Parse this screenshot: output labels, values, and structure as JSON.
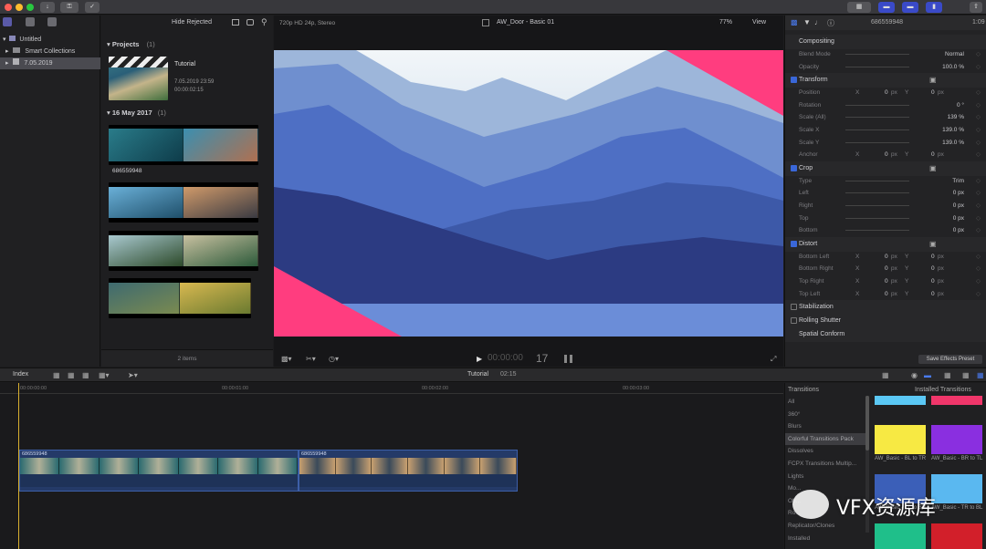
{
  "toolbar": {
    "icons": [
      "download-icon",
      "key-icon",
      "check-circle-icon"
    ],
    "right_icons": [
      "keyword-icon",
      "layout-browser-icon",
      "layout-timeline-icon",
      "layout-inspector-icon",
      "share-icon"
    ]
  },
  "library": {
    "items": [
      {
        "label": "Untitled",
        "icon": "library-icon"
      },
      {
        "label": "Smart Collections",
        "icon": "folder-icon"
      },
      {
        "label": "7.05.2019",
        "icon": "event-icon"
      }
    ]
  },
  "browser": {
    "filter": "Hide Rejected",
    "sections": [
      {
        "title": "Projects",
        "count": "(1)"
      },
      {
        "title": "16 May 2017",
        "count": "(1)"
      }
    ],
    "project": {
      "name": "Tutorial",
      "date": "7.05.2019 23:59",
      "duration": "00:00:02:15"
    },
    "clip_label": "686559948",
    "footer": "2 items"
  },
  "viewer": {
    "format": "720p HD 24p, Stereo",
    "title": "AW_Door - Basic 01",
    "zoom": "77%",
    "view": "View",
    "timecode_dim": "00:00:00",
    "timecode": "17",
    "accent_pink": "#ff3d7f"
  },
  "inspector": {
    "clip_name": "686559948",
    "duration": "1:09",
    "rows": [
      {
        "type": "head",
        "label": "Compositing"
      },
      {
        "type": "row",
        "label": "Blend Mode",
        "value": "Normal"
      },
      {
        "type": "row",
        "label": "Opacity",
        "value": "100.0 %"
      },
      {
        "type": "chk",
        "label": "Transform"
      },
      {
        "type": "xy",
        "label": "Position",
        "x": "0",
        "y": "0",
        "unit": "px"
      },
      {
        "type": "row",
        "label": "Rotation",
        "value": "0 °"
      },
      {
        "type": "row",
        "label": "Scale (All)",
        "value": "139 %"
      },
      {
        "type": "row",
        "label": "Scale X",
        "value": "139.0 %"
      },
      {
        "type": "row",
        "label": "Scale Y",
        "value": "139.0 %"
      },
      {
        "type": "xy",
        "label": "Anchor",
        "x": "0",
        "y": "0",
        "unit": "px"
      },
      {
        "type": "chk",
        "label": "Crop"
      },
      {
        "type": "row",
        "label": "Type",
        "value": "Trim"
      },
      {
        "type": "row",
        "label": "Left",
        "value": "0 px"
      },
      {
        "type": "row",
        "label": "Right",
        "value": "0 px"
      },
      {
        "type": "row",
        "label": "Top",
        "value": "0 px"
      },
      {
        "type": "row",
        "label": "Bottom",
        "value": "0 px"
      },
      {
        "type": "chk",
        "label": "Distort"
      },
      {
        "type": "xy",
        "label": "Bottom Left",
        "x": "0",
        "y": "0",
        "unit": "px"
      },
      {
        "type": "xy",
        "label": "Bottom Right",
        "x": "0",
        "y": "0",
        "unit": "px"
      },
      {
        "type": "xy",
        "label": "Top Right",
        "x": "0",
        "y": "0",
        "unit": "px"
      },
      {
        "type": "xy",
        "label": "Top Left",
        "x": "0",
        "y": "0",
        "unit": "px"
      },
      {
        "type": "off",
        "label": "Stabilization"
      },
      {
        "type": "off",
        "label": "Rolling Shutter"
      },
      {
        "type": "head",
        "label": "Spatial Conform"
      }
    ],
    "save_preset": "Save Effects Preset"
  },
  "timeline": {
    "index": "Index",
    "project": "Tutorial",
    "duration": "02:15",
    "ruler": [
      "00:00:00:00",
      "00:00:01:00",
      "00:00:02:00",
      "00:00:03:00"
    ],
    "clips": [
      {
        "label": "686559948"
      },
      {
        "label": "686559948"
      }
    ]
  },
  "transitions": {
    "title": "Transitions",
    "section": "Installed Transitions",
    "categories": [
      "All",
      "360°",
      "Blurs",
      "Colorful Transitions Pack",
      "Dissolves",
      "FCPX Transitions Multip...",
      "Lights",
      "Mo...",
      "Ob...",
      "Ro...",
      "Replicator/Clones",
      "Installed"
    ],
    "tiles": [
      {
        "label": "",
        "color": "#5bc8f5"
      },
      {
        "label": "",
        "color": "#f0366a"
      },
      {
        "label": "AW_Basic - BL to TR",
        "color": "#f7e943"
      },
      {
        "label": "AW_Basic - BR to TL",
        "color": "#8a2fe0"
      },
      {
        "label": "AW_Basic - TL to BR",
        "color": "#3b5fb8"
      },
      {
        "label": "AW_Basic - TR to BL",
        "color": "#5ab8f0"
      },
      {
        "label": "AW_Basic - ...",
        "color": "#1fbf8a"
      },
      {
        "label": "AW_Basic - Basic",
        "color": "#d21f2a"
      }
    ],
    "footer_right": "21 items"
  },
  "watermark": "VFX资源库"
}
